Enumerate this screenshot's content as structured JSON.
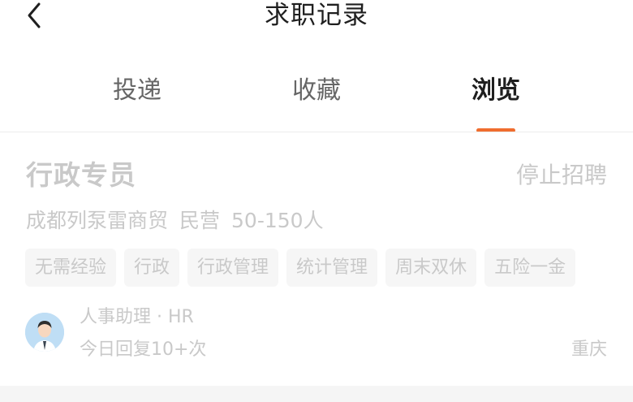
{
  "header": {
    "title": "求职记录",
    "back_icon": "chevron-left-icon"
  },
  "tabs": [
    {
      "label": "投递",
      "active": false
    },
    {
      "label": "收藏",
      "active": false
    },
    {
      "label": "浏览",
      "active": true
    }
  ],
  "accent_color": "#f06d2e",
  "job_card": {
    "title": "行政专员",
    "status": "停止招聘",
    "company": "成都列泵雷商贸",
    "company_type": "民营",
    "company_size": "50-150人",
    "tags": [
      "无需经验",
      "行政",
      "行政管理",
      "统计管理",
      "周末双休",
      "五险一金"
    ],
    "recruiter": {
      "name_role": "人事助理 · HR",
      "reply_info": "今日回复10+次",
      "avatar_icon": "person-avatar-icon"
    },
    "city": "重庆"
  }
}
